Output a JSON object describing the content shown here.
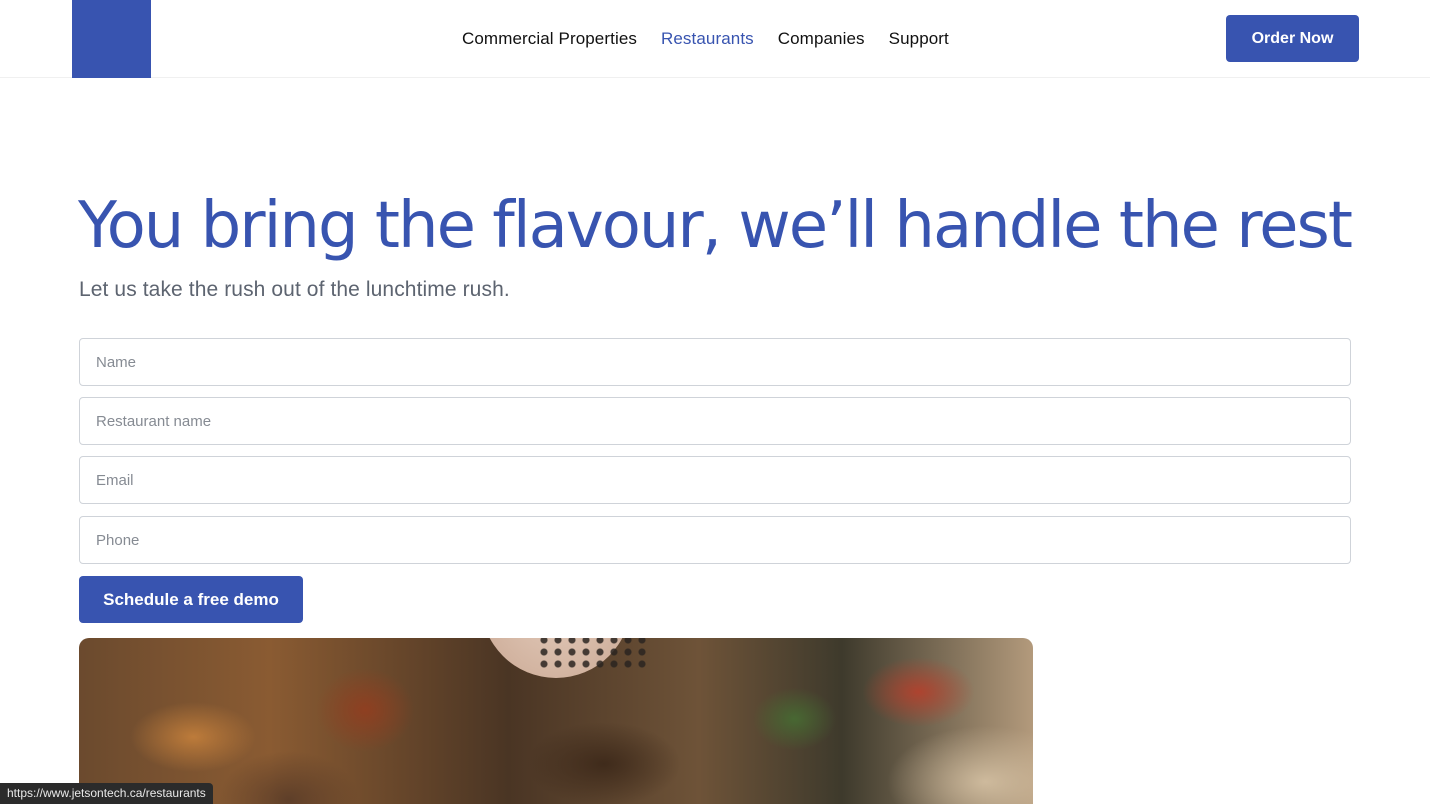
{
  "header": {
    "nav": [
      {
        "label": "Commercial Properties",
        "active": false
      },
      {
        "label": "Restaurants",
        "active": true
      },
      {
        "label": "Companies",
        "active": false
      },
      {
        "label": "Support",
        "active": false
      }
    ],
    "order_button": "Order Now"
  },
  "hero": {
    "title": "You bring the flavour, we’ll handle the rest",
    "subtitle": "Let us take the rush out of the lunchtime rush."
  },
  "form": {
    "name_placeholder": "Name",
    "restaurant_placeholder": "Restaurant name",
    "email_placeholder": "Email",
    "phone_placeholder": "Phone",
    "submit_label": "Schedule a free demo"
  },
  "status_bar": {
    "url": "https://www.jetsontech.ca/restaurants"
  },
  "colors": {
    "brand": "#3854b0",
    "subtitle": "#5d6470",
    "border": "#cfd3d9"
  }
}
